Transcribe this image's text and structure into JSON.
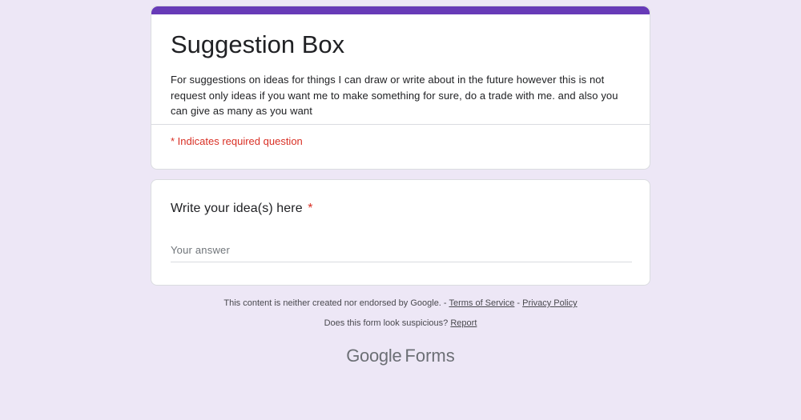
{
  "form": {
    "title": "Suggestion Box",
    "description": "For suggestions on ideas for things I can draw or write about in the future however this is not request only ideas if you want me to make something for sure, do a trade with me. and also you can give as many as you want",
    "required_note": "* Indicates required question",
    "accent_color": "#673ab7",
    "background_color": "#ede7f6"
  },
  "question": {
    "title": "Write your idea(s) here",
    "required_marker": "*",
    "answer_placeholder": "Your answer",
    "answer_value": ""
  },
  "footer": {
    "disclaimer": "This content is neither created nor endorsed by Google.",
    "separator1": " - ",
    "terms_label": "Terms of Service",
    "separator2": " - ",
    "privacy_label": "Privacy Policy",
    "suspicious_text": "Does this form look suspicious?",
    "report_label": "Report"
  },
  "brand": {
    "logo_text": "Google",
    "product_text": "Forms"
  }
}
